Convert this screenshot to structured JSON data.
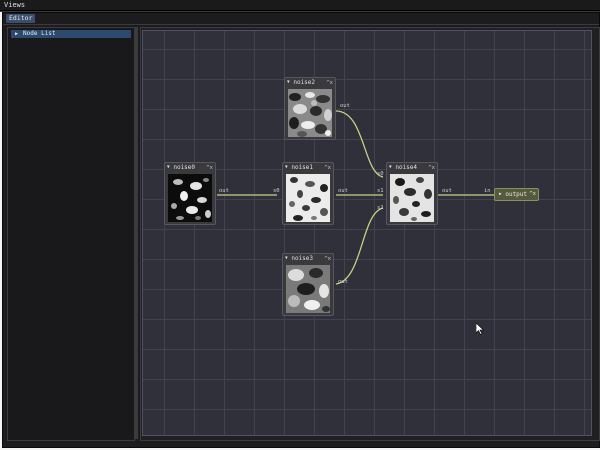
{
  "titlebar": {
    "title": "Views"
  },
  "tabs": [
    {
      "label": "Editor"
    }
  ],
  "sidebar": {
    "header_label": "Node List"
  },
  "graph": {
    "nodes": {
      "noise0": {
        "title": "noise0",
        "controls": "^x",
        "pins_out": [
          "out"
        ],
        "pins_in": []
      },
      "noise1": {
        "title": "noise1",
        "controls": "^x",
        "pins_out": [
          "out"
        ],
        "pins_in": [
          "s0"
        ]
      },
      "noise2": {
        "title": "noise2",
        "controls": "^x",
        "pins_out": [
          "out"
        ],
        "pins_in": []
      },
      "noise3": {
        "title": "noise3",
        "controls": "^x",
        "pins_out": [
          "out"
        ],
        "pins_in": []
      },
      "noise4": {
        "title": "noise4",
        "controls": "^x",
        "pins_out": [
          "out"
        ],
        "pins_in": [
          "s0",
          "s1",
          "s2"
        ]
      }
    },
    "output": {
      "title": "output",
      "controls": "^x",
      "pins_in": [
        "in"
      ]
    },
    "link_color": "#c9cf86"
  },
  "colors": {
    "tab_active": "#3a4f6e",
    "canvas_bg": "#2f3039",
    "grid_line": "#41434f",
    "node_bg": "#3a3a3e",
    "output_node_bg": "#555a3e"
  }
}
